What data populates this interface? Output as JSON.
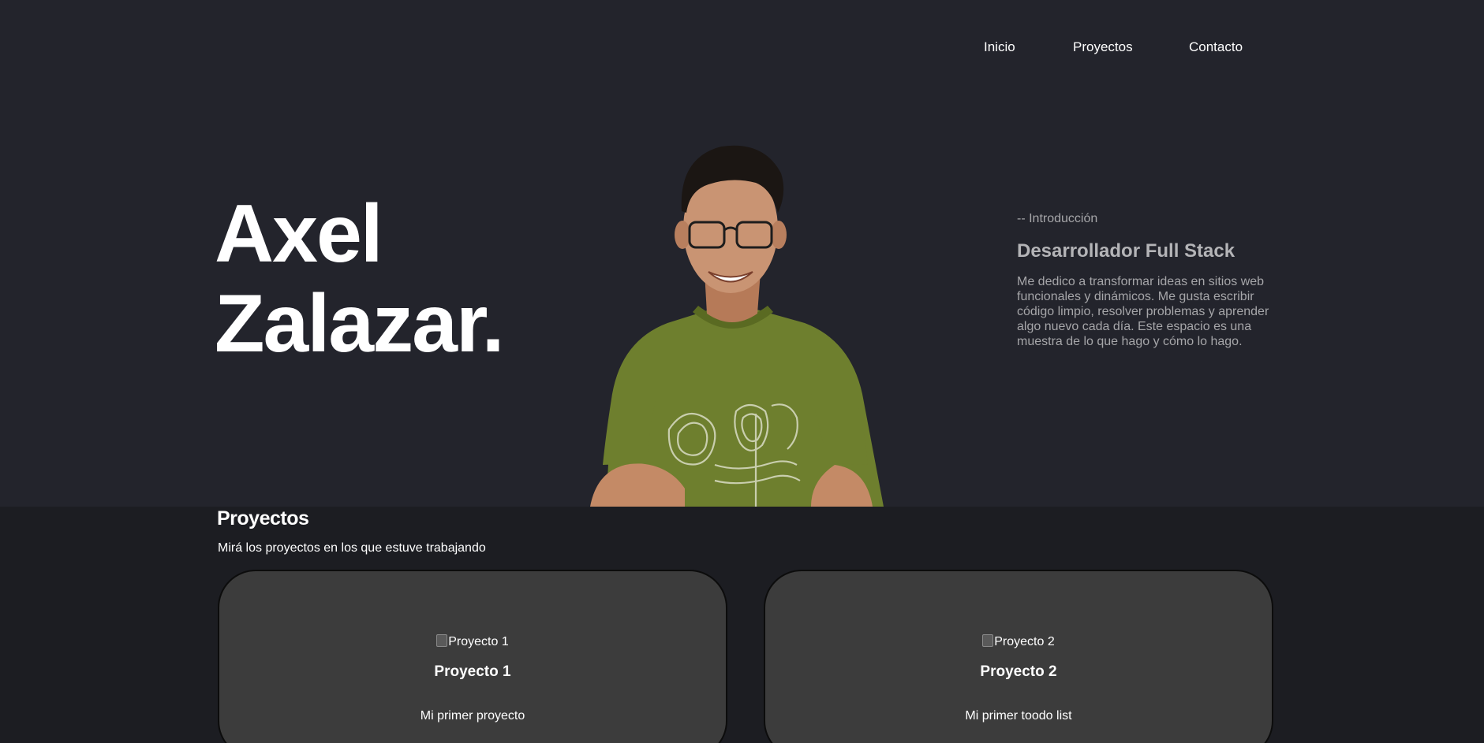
{
  "nav": {
    "links": [
      {
        "label": "Inicio"
      },
      {
        "label": "Proyectos"
      },
      {
        "label": "Contacto"
      }
    ]
  },
  "hero": {
    "name_line1": "Axel",
    "name_line2": "Zalazar.",
    "intro_label": "-- Introducción",
    "role": "Desarrollador Full Stack",
    "description": "Me dedico a transformar ideas en sitios web funcionales y dinámicos. Me gusta escribir código limpio, resolver problemas y aprender algo nuevo cada día. Este espacio es una muestra de lo que hago y cómo lo hago."
  },
  "projects": {
    "title": "Proyectos",
    "subtitle": "Mirá los proyectos en los que estuve trabajando",
    "cards": [
      {
        "image_alt": "Proyecto 1",
        "title": "Proyecto 1",
        "description": "Mi primer proyecto"
      },
      {
        "image_alt": "Proyecto 2",
        "title": "Proyecto 2",
        "description": "Mi primer toodo list"
      }
    ]
  },
  "colors": {
    "hero_bg": "#23242c",
    "page_bg": "#1c1d22",
    "card_bg": "#3c3c3c",
    "shirt": "#6e7f2e",
    "text_muted": "#a6a6a9"
  }
}
